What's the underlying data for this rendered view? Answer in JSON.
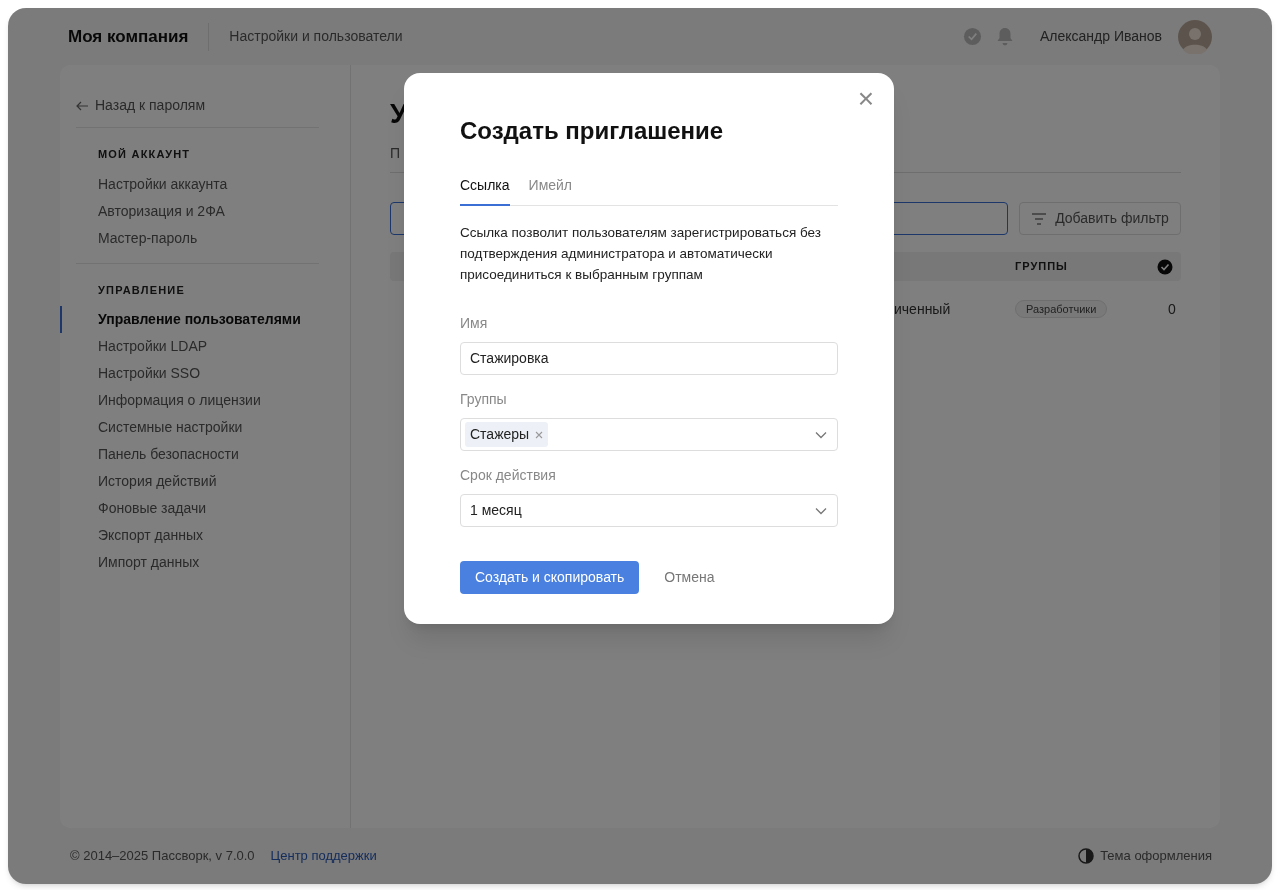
{
  "header": {
    "company": "Моя компания",
    "section": "Настройки и пользователи",
    "user_name": "Александр Иванов"
  },
  "sidebar": {
    "back_link": "Назад к паролям",
    "groups": [
      {
        "title": "МОЙ АККАУНТ",
        "items": [
          {
            "label": "Настройки аккаунта",
            "selected": false
          },
          {
            "label": "Авторизация и 2ФА",
            "selected": false
          },
          {
            "label": "Мастер-пароль",
            "selected": false
          }
        ]
      },
      {
        "title": "УПРАВЛЕНИЕ",
        "items": [
          {
            "label": "Управление пользователями",
            "selected": true
          },
          {
            "label": "Настройки LDAP",
            "selected": false
          },
          {
            "label": "Настройки SSO",
            "selected": false
          },
          {
            "label": "Информация о лицензии",
            "selected": false
          },
          {
            "label": "Системные настройки",
            "selected": false
          },
          {
            "label": "Панель безопасности",
            "selected": false
          },
          {
            "label": "История действий",
            "selected": false
          },
          {
            "label": "Фоновые задачи",
            "selected": false
          },
          {
            "label": "Экспорт данных",
            "selected": false
          },
          {
            "label": "Импорт данных",
            "selected": false
          }
        ]
      }
    ]
  },
  "main": {
    "heading": "У",
    "tab_fragment": "П",
    "search": {
      "focused": true
    },
    "filter_button": "Добавить фильтр",
    "table": {
      "columns": [
        "ГРУППЫ"
      ],
      "rows": [
        {
          "column_3": "иченный",
          "groups": [
            "Разработчики"
          ],
          "count": "0"
        }
      ]
    }
  },
  "modal": {
    "title": "Создать приглашение",
    "close": "×",
    "tabs": [
      {
        "label": "Ссылка",
        "selected": true
      },
      {
        "label": "Имейл",
        "selected": false
      }
    ],
    "description": "Ссылка позволит пользователям зарегистрироваться без подтверждения администратора и автоматически присоединиться к выбранным группам",
    "fields": [
      {
        "kind": "text",
        "label": "Имя",
        "value": "Стажировка"
      },
      {
        "kind": "tags",
        "label": "Группы",
        "tags": [
          "Стажеры"
        ]
      },
      {
        "kind": "select",
        "label": "Срок действия",
        "value": "1 месяц"
      }
    ],
    "primary_button": "Создать и скопировать",
    "cancel_button": "Отмена"
  },
  "footer": {
    "copyright": "© 2014–2025 Пассворк, v 7.0.0",
    "support_link": "Центр поддержки",
    "theme_toggle": "Тема оформления"
  }
}
